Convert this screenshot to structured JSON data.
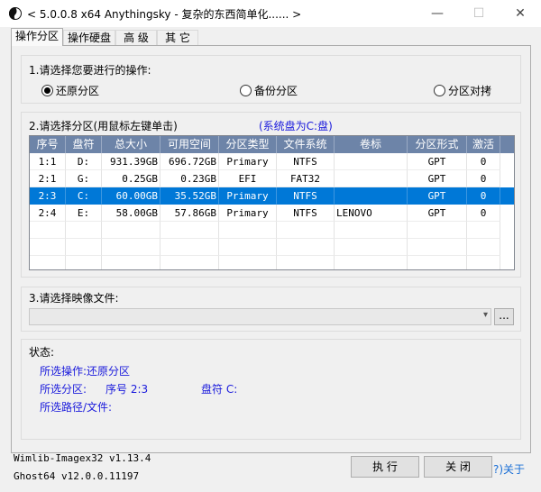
{
  "window": {
    "title": "< 5.0.0.8 x64 Anythingsky - 复杂的东西简单化...... >",
    "minimize_glyph": "—",
    "maximize_glyph": "☐",
    "close_glyph": "✕"
  },
  "tabs": [
    "操作分区",
    "操作硬盘",
    "高 级",
    "其 它"
  ],
  "step1": {
    "label": "1.请选择您要进行的操作:",
    "options": [
      {
        "label": "还原分区",
        "selected": true
      },
      {
        "label": "备份分区",
        "selected": false
      },
      {
        "label": "分区对拷",
        "selected": false
      }
    ]
  },
  "step2": {
    "label": "2.请选择分区(用鼠标左键单击)",
    "system_note": "(系统盘为C:盘)",
    "columns": [
      "序号",
      "盘符",
      "总大小",
      "可用空间",
      "分区类型",
      "文件系统",
      "卷标",
      "分区形式",
      "激活"
    ],
    "rows": [
      [
        "1:1",
        "D:",
        "931.39GB",
        "696.72GB",
        "Primary",
        "NTFS",
        "",
        "GPT",
        "0"
      ],
      [
        "2:1",
        "G:",
        "0.25GB",
        "0.23GB",
        "EFI",
        "FAT32",
        "",
        "GPT",
        "0"
      ],
      [
        "2:3",
        "C:",
        "60.00GB",
        "35.52GB",
        "Primary",
        "NTFS",
        "",
        "GPT",
        "0"
      ],
      [
        "2:4",
        "E:",
        "58.00GB",
        "57.86GB",
        "Primary",
        "NTFS",
        "LENOVO",
        "GPT",
        "0"
      ]
    ],
    "selected_row": 2
  },
  "step3": {
    "label": "3.请选择映像文件:",
    "value": "",
    "browse_label": "..."
  },
  "status": {
    "label": "状态:",
    "operation": "所选操作:还原分区",
    "partition_prefix": "所选分区:",
    "partition_index": "序号 2:3",
    "partition_drive": "盘符 C:",
    "path": "所选路径/文件:"
  },
  "footer": {
    "wimlib": "Wimlib-Imagex32 v1.13.4",
    "ghost": "Ghost64 v12.0.0.11197",
    "execute_label": "执 行",
    "close_label": "关 闭",
    "about_label": "?)关于"
  },
  "colors": {
    "accent": "#0078d7",
    "header": "#6d84a8",
    "status_text": "#1a1adc"
  }
}
